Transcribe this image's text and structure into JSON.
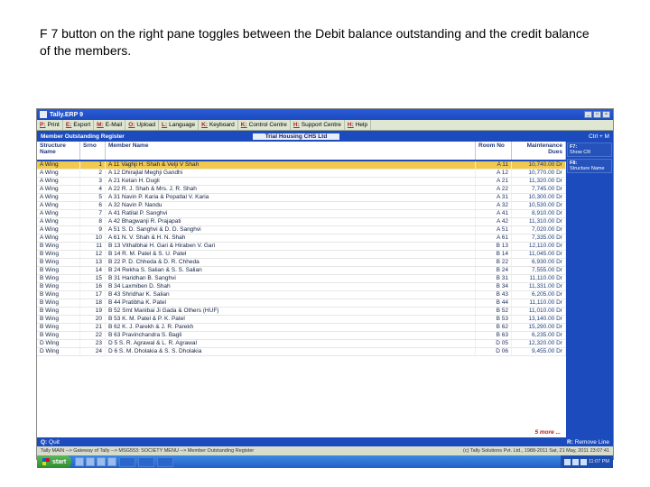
{
  "caption": "F 7 button on the right pane toggles between the Debit balance outstanding and the credit balance of the members.",
  "titlebar": {
    "app": "Tally.ERP 9"
  },
  "toolbar": [
    {
      "key": "P:",
      "label": "Print"
    },
    {
      "key": "E:",
      "label": "Export"
    },
    {
      "key": "M:",
      "label": "E-Mail"
    },
    {
      "key": "O:",
      "label": "Upload"
    },
    {
      "key": "L:",
      "label": "Language"
    },
    {
      "key": "K:",
      "label": "Keyboard"
    },
    {
      "key": "K:",
      "label": "Control Centre"
    },
    {
      "key": "H:",
      "label": "Support Centre"
    },
    {
      "key": "H:",
      "label": "Help"
    }
  ],
  "headerrow": {
    "left": "Member Outstanding Register",
    "company": "Trial Housing CHS Ltd",
    "shortcut": "Ctrl + M"
  },
  "sidepane": [
    {
      "fk": "F7:",
      "label": "Show CR"
    },
    {
      "fk": "F8:",
      "label": "Structure Name"
    }
  ],
  "columns": {
    "struct": "Structure Name",
    "srno": "Srno",
    "member": "Member Name",
    "room": "Room No",
    "maint": "Maintenance Dues"
  },
  "rows": [
    {
      "struct": "A Wing",
      "sr": "1",
      "name": "A 11 Vaghji H. Shah & Velji V Shah",
      "room": "A 11",
      "amt": "10,740.00 Dr",
      "hl": true
    },
    {
      "struct": "A Wing",
      "sr": "2",
      "name": "A 12 Dhirajlal Meghji Gandhi",
      "room": "A 12",
      "amt": "10,770.00 Dr"
    },
    {
      "struct": "A Wing",
      "sr": "3",
      "name": "A 21 Ketan H. Dugli",
      "room": "A 21",
      "amt": "11,320.00 Dr"
    },
    {
      "struct": "A Wing",
      "sr": "4",
      "name": "A 22 R. J. Shah & Mrs. J. R. Shah",
      "room": "A 22",
      "amt": "7,745.00 Dr"
    },
    {
      "struct": "A Wing",
      "sr": "5",
      "name": "A 31 Navin P. Karia & Popatlal V. Karia",
      "room": "A 31",
      "amt": "10,300.00 Dr"
    },
    {
      "struct": "A Wing",
      "sr": "6",
      "name": "A 32 Navin P. Nandu",
      "room": "A 32",
      "amt": "10,530.00 Dr"
    },
    {
      "struct": "A Wing",
      "sr": "7",
      "name": "A 41 Ratilal P. Sanghvi",
      "room": "A 41",
      "amt": "8,910.00 Dr"
    },
    {
      "struct": "A Wing",
      "sr": "8",
      "name": "A 42 Bhagwanji R. Prajapati",
      "room": "A 42",
      "amt": "11,310.00 Dr"
    },
    {
      "struct": "A Wing",
      "sr": "9",
      "name": "A 51 S. D. Sanghvi & D. D. Sanghvi",
      "room": "A 51",
      "amt": "7,020.00 Dr"
    },
    {
      "struct": "A Wing",
      "sr": "10",
      "name": "A 61 N. V. Shah & H. N. Shah",
      "room": "A 61",
      "amt": "7,335.00 Dr"
    },
    {
      "struct": "B Wing",
      "sr": "11",
      "name": "B 13 Vithalbhai H. Gari & Hiraben V. Gari",
      "room": "B 13",
      "amt": "12,110.00 Dr"
    },
    {
      "struct": "B Wing",
      "sr": "12",
      "name": "B 14 R. M. Patel & S. U. Patel",
      "room": "B 14",
      "amt": "11,045.00 Dr"
    },
    {
      "struct": "B Wing",
      "sr": "13",
      "name": "B 22 P. D. Chheda & D. R. Chheda",
      "room": "B 22",
      "amt": "6,930.00 Dr"
    },
    {
      "struct": "B Wing",
      "sr": "14",
      "name": "B 24 Rekha S. Salian & S. S. Salian",
      "room": "B 24",
      "amt": "7,555.00 Dr"
    },
    {
      "struct": "B Wing",
      "sr": "15",
      "name": "B 31 Haridhan B. Sanghvi",
      "room": "B 31",
      "amt": "11,110.00 Dr"
    },
    {
      "struct": "B Wing",
      "sr": "16",
      "name": "B 34 Laxmiben D. Shah",
      "room": "B 34",
      "amt": "11,331.00 Dr"
    },
    {
      "struct": "B Wing",
      "sr": "17",
      "name": "B 43 Shridhar K. Salian",
      "room": "B 43",
      "amt": "6,205.00 Dr"
    },
    {
      "struct": "B Wing",
      "sr": "18",
      "name": "B 44 Pratibha K. Patel",
      "room": "B 44",
      "amt": "11,110.00 Dr"
    },
    {
      "struct": "B Wing",
      "sr": "19",
      "name": "B 52 Smt Manibai Ji Gada & Others (HUF)",
      "room": "B 52",
      "amt": "11,010.00 Dr"
    },
    {
      "struct": "B Wing",
      "sr": "20",
      "name": "B 53 K. M. Patel & P. K. Patel",
      "room": "B 53",
      "amt": "13,140.00 Dr"
    },
    {
      "struct": "B Wing",
      "sr": "21",
      "name": "B 62 K. J. Parekh & J. R. Parekh",
      "room": "B 62",
      "amt": "15,290.00 Dr"
    },
    {
      "struct": "B Wing",
      "sr": "22",
      "name": "B 63 Pravinchandra S. Bagli",
      "room": "B 63",
      "amt": "6,235.00 Dr"
    },
    {
      "struct": "D Wing",
      "sr": "23",
      "name": "D 5 S. R. Agrawal & L. R. Agrawal",
      "room": "D 05",
      "amt": "12,320.00 Dr"
    },
    {
      "struct": "D Wing",
      "sr": "24",
      "name": "D 6 S. M. Dholakia & S. S. Dholakia",
      "room": "D 06",
      "amt": "9,455.00 Dr"
    }
  ],
  "more": "5 more ...",
  "bottom1": {
    "left_key": "Q:",
    "left_label": "Quit",
    "right_key": "R:",
    "right_label": "Remove Line"
  },
  "bottom2": {
    "left": "Tally MAIN --> Gateway of Tally --> MSG553: SOCIETY MENU --> Member Outstanding Register",
    "right": "(c) Tally Solutions Pvt. Ltd., 1988-2011   Sat, 21 May, 2011   23:07:41"
  },
  "taskbar": {
    "start": "start",
    "qcount": 4,
    "tasks": [
      "",
      "",
      ""
    ],
    "time": "11:07 PM"
  }
}
